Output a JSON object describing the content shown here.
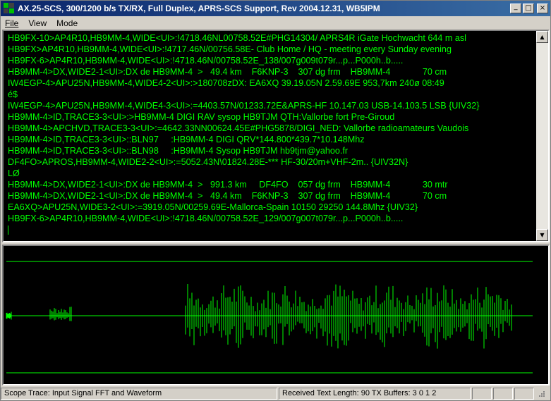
{
  "window": {
    "title": "AX.25-SCS, 300/1200 b/s TX/RX, Full Duplex, APRS-SCS Support, Rev 2004.12.31, WB5IPM",
    "minimize_glyph": "_",
    "maximize_glyph": "□",
    "close_glyph": "×"
  },
  "menu": [
    {
      "label": "File",
      "accel": "F"
    },
    {
      "label": "View"
    },
    {
      "label": "Mode"
    }
  ],
  "terminal": {
    "text_color": "#00ff00",
    "background": "#000000",
    "lines": [
      "HB9FX-10>AP4R10,HB9MM-4,WIDE<UI>:!4718.46NL00758.52E#PHG14304/ APRS4R iGate Hochwacht 644 m asl",
      "HB9FX>AP4R10,HB9MM-4,WIDE<UI>:!4717.46N/00756.58E- Club Home / HQ - meeting every Sunday evening",
      "HB9FX-6>AP4R10,HB9MM-4,WIDE<UI>:!4718.46N/00758.52E_138/007g009t079r...p...P000h..b.....",
      "HB9MM-4>DX,WIDE2-1<UI>:DX de HB9MM-4  >   49.4 km    F6KNP-3    307 dg frm    HB9MM-4             70 cm",
      "IW4EGP-4>APU25N,HB9MM-4,WIDE4-2<UI>:>180708zDX: EA6XQ 39.19.05N 2.59.69E 953,7km 240ø 08:49",
      "é$",
      "IW4EGP-4>APU25N,HB9MM-4,WIDE4-3<UI>:=4403.57N/01233.72E&APRS-HF 10.147.03 USB-14.103.5 LSB {UIV32}",
      "HB9MM-4>ID,TRACE3-3<UI>:>HB9MM-4 DIGI RAV sysop HB9TJM QTH:Vallorbe fort Pre-Giroud",
      "HB9MM-4>APCHVD,TRACE3-3<UI>:=4642.33NN00624.45E#PHG5878/DIGI_NED: Vallorbe radioamateurs Vaudois",
      "HB9MM-4>ID,TRACE3-3<UI>::BLN97     :HB9MM-4 DIGI QRV*144.800*439.7*10.148Mhz",
      "HB9MM-4>ID,TRACE3-3<UI>::BLN98     :HB9MM-4 Sysop HB9TJM hb9tjm@yahoo.fr",
      "DF4FO>APROS,HB9MM-4,WIDE2-2<UI>:=5052.43N\\01824.28E-*** HF-30/20m+VHF-2m.. {UIV32N}",
      "LØ",
      "HB9MM-4>DX,WIDE2-1<UI>:DX de HB9MM-4  >   991.3 km     DF4FO    057 dg frm    HB9MM-4             30 mtr",
      "HB9MM-4>DX,WIDE2-1<UI>:DX de HB9MM-4  >   49.4 km    F6KNP-3    307 dg frm    HB9MM-4             70 cm",
      "EA6XQ>APU25N,WIDE3-2<UI>:=3919.05N/00259.69E-Mallorca-Spain 10150 29250 144.8Mhz {UIV32}",
      "HB9FX-6>AP4R10,HB9MM-4,WIDE<UI>:!4718.46N/00758.52E_129/007g007t079r...p...P000h..b....."
    ]
  },
  "scope": {
    "trace_color": "#00ff00",
    "background": "#000000"
  },
  "status": {
    "scope_trace": "Scope Trace:  Input Signal FFT and Waveform",
    "received": "Received Text Length:  90  TX Buffers:  3 0 1 2"
  }
}
